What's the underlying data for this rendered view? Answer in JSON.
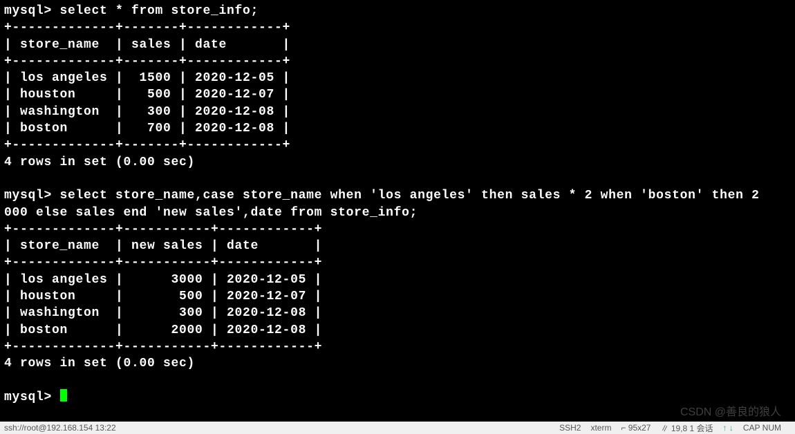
{
  "prompt": "mysql> ",
  "query1": {
    "sql": "select * from store_info;",
    "border_top": "+-------------+-------+------------+",
    "header_row": "| store_name  | sales | date       |",
    "border_mid": "+-------------+-------+------------+",
    "rows": [
      "| los angeles |  1500 | 2020-12-05 |",
      "| houston     |   500 | 2020-12-07 |",
      "| washington  |   300 | 2020-12-08 |",
      "| boston      |   700 | 2020-12-08 |"
    ],
    "border_bot": "+-------------+-------+------------+",
    "summary": "4 rows in set (0.00 sec)"
  },
  "query2": {
    "sql_line1": "select store_name,case store_name when 'los angeles' then sales * 2 when 'boston' then 2",
    "sql_line2": "000 else sales end 'new sales',date from store_info;",
    "border_top": "+-------------+-----------+------------+",
    "header_row": "| store_name  | new sales | date       |",
    "border_mid": "+-------------+-----------+------------+",
    "rows": [
      "| los angeles |      3000 | 2020-12-05 |",
      "| houston     |       500 | 2020-12-07 |",
      "| washington  |       300 | 2020-12-08 |",
      "| boston      |      2000 | 2020-12-08 |"
    ],
    "border_bot": "+-------------+-----------+------------+",
    "summary": "4 rows in set (0.00 sec)"
  },
  "watermark": "CSDN @善良的狼人",
  "statusbar": {
    "left": "ssh://root@192.168.154 13:22",
    "ssh": "SSH2",
    "term": "xterm",
    "size": "⌐ 95x27",
    "other": "∥ 19,8  1 会话",
    "arrows": "↑  ↓",
    "caps": "CAP  NUM"
  }
}
